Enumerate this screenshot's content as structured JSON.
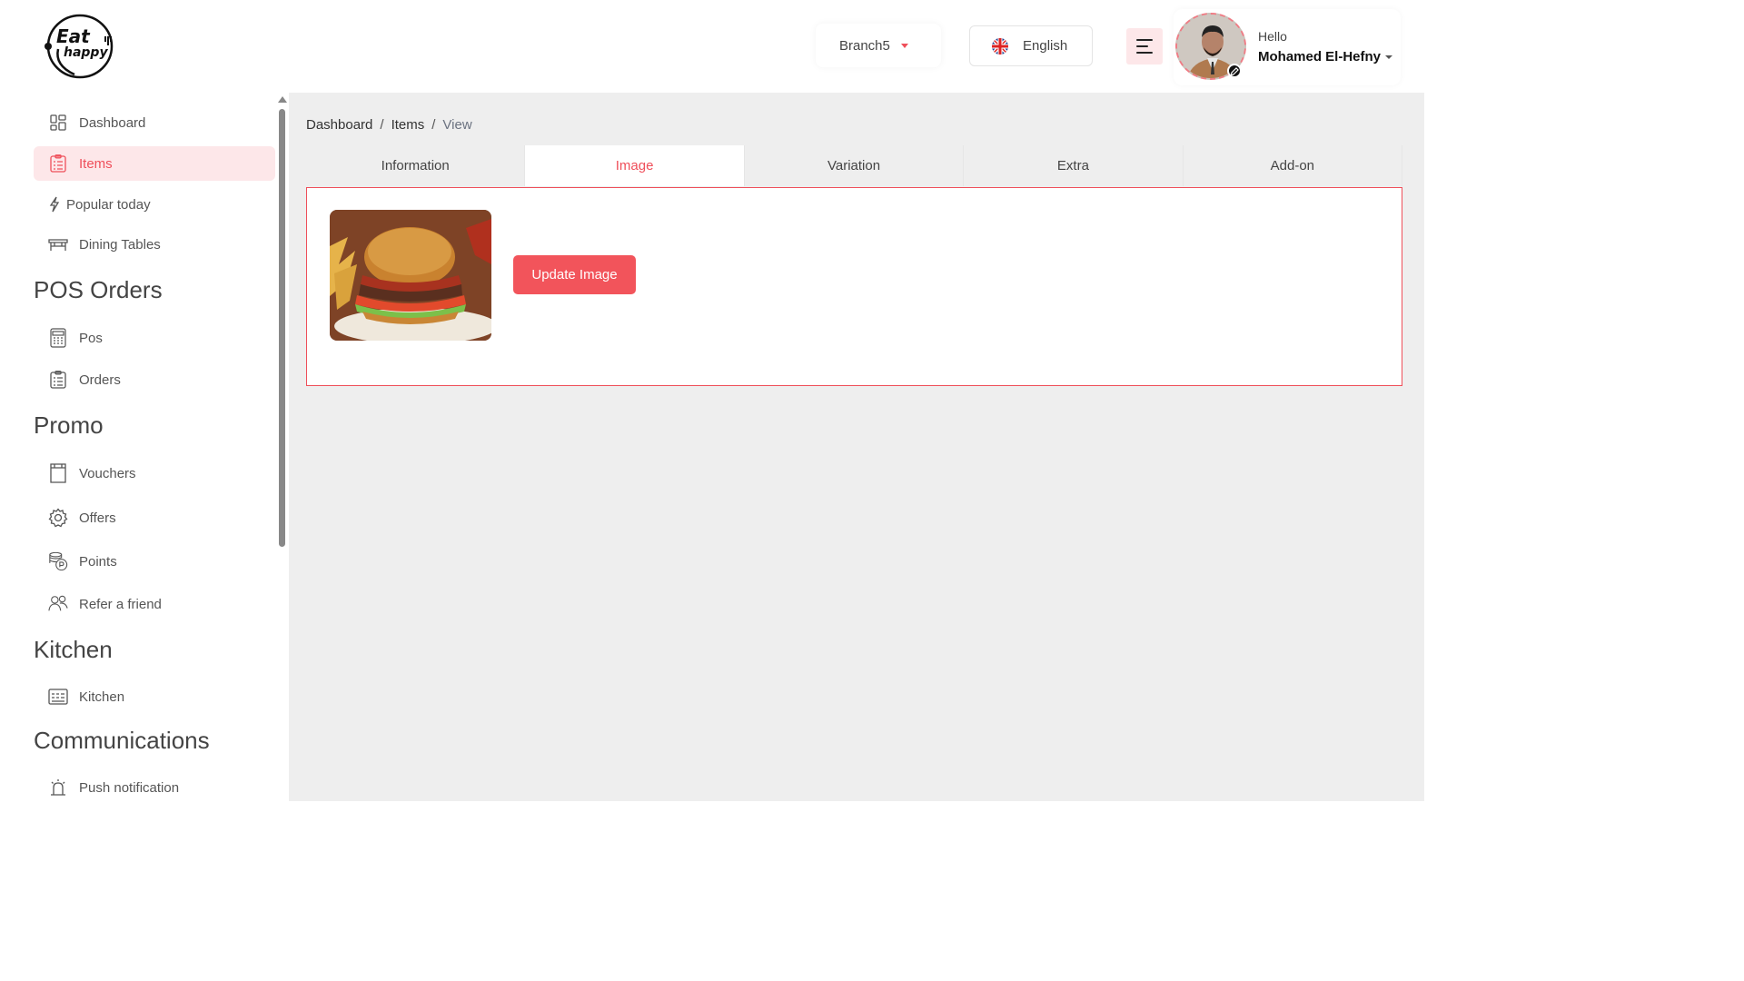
{
  "header": {
    "logo_text": [
      "Eat",
      "happy"
    ],
    "branch": "Branch5",
    "language": "English",
    "greeting": "Hello",
    "user_name": "Mohamed El-Hefny"
  },
  "sidebar": {
    "items": [
      {
        "label": "Dashboard",
        "icon": "dashboard-icon"
      },
      {
        "label": "Items",
        "icon": "items-icon",
        "active": true
      },
      {
        "label": "Popular today",
        "icon": "lightning-icon"
      },
      {
        "label": "Dining Tables",
        "icon": "table-icon"
      }
    ],
    "sections": [
      {
        "title": "POS Orders",
        "items": [
          {
            "label": "Pos",
            "icon": "pos-icon"
          },
          {
            "label": "Orders",
            "icon": "orders-icon"
          }
        ]
      },
      {
        "title": "Promo",
        "items": [
          {
            "label": "Vouchers",
            "icon": "voucher-icon"
          },
          {
            "label": "Offers",
            "icon": "offers-icon"
          },
          {
            "label": "Points",
            "icon": "points-icon"
          },
          {
            "label": "Refer a friend",
            "icon": "refer-icon"
          }
        ]
      },
      {
        "title": "Kitchen",
        "items": [
          {
            "label": "Kitchen",
            "icon": "kitchen-icon"
          }
        ]
      },
      {
        "title": "Communications",
        "items": [
          {
            "label": "Push notification",
            "icon": "bell-icon"
          }
        ]
      }
    ]
  },
  "breadcrumb": [
    "Dashboard",
    "Items",
    "View"
  ],
  "tabs": [
    "Information",
    "Image",
    "Variation",
    "Extra",
    "Add-on"
  ],
  "active_tab": "Image",
  "panel": {
    "update_button": "Update Image"
  },
  "colors": {
    "accent": "#ef4f5a",
    "accent_bg": "#fde7e9",
    "main_bg": "#eeeeee"
  }
}
